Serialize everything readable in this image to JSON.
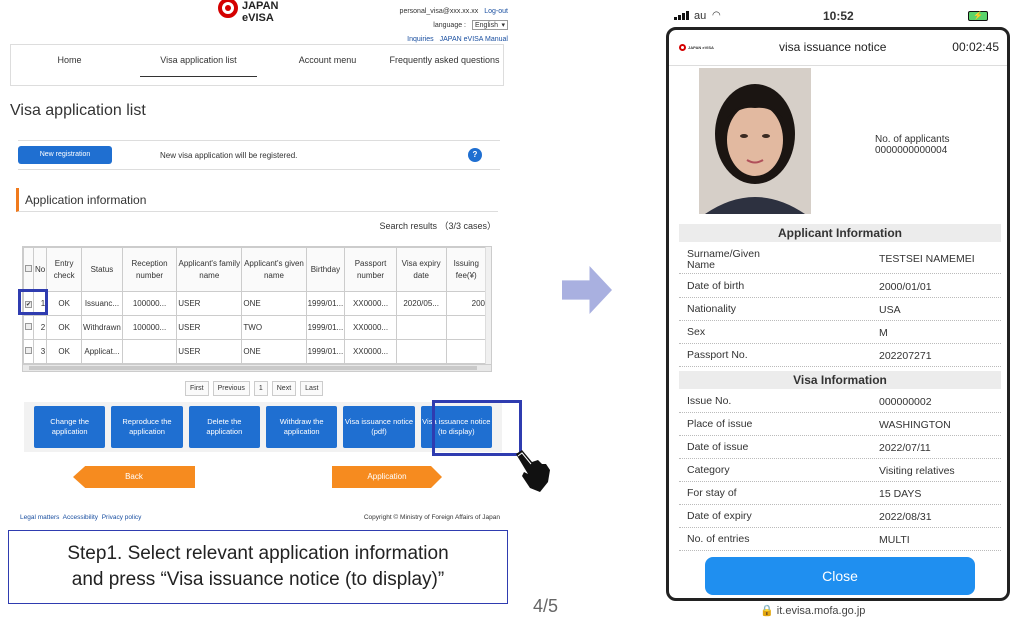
{
  "header": {
    "logo_line1": "JAPAN",
    "logo_line2": "eVISA",
    "email": "personal_visa@xxx.xx.xx",
    "logout": "Log-out",
    "language_label": "language :",
    "language_value": "English",
    "inquiries": "Inquiries",
    "manual": "JAPAN eVISA Manual"
  },
  "nav": {
    "items": [
      "Home",
      "Visa application list",
      "Account menu",
      "Frequently asked questions"
    ]
  },
  "page_title": "Visa application list",
  "registration": {
    "button": "New registration",
    "text": "New visa application will be registered.",
    "help": "?"
  },
  "section_title": "Application information",
  "search_results": "Search results （3/3 cases）",
  "table": {
    "headers": [
      "No",
      "Entry check",
      "Status",
      "Reception number",
      "Applicant's family name",
      "Applicant's given name",
      "Birthday",
      "Passport number",
      "Visa expiry date",
      "Issuing fee(¥)"
    ],
    "rows": [
      {
        "checked": "✔",
        "no": "1",
        "entry": "OK",
        "status": "Issuanc...",
        "reception": "100000...",
        "family": "USER",
        "given": "ONE",
        "birthday": "1999/01...",
        "passport": "XX0000...",
        "expiry": "2020/05...",
        "fee": "200"
      },
      {
        "checked": "",
        "no": "2",
        "entry": "OK",
        "status": "Withdrawn",
        "reception": "100000...",
        "family": "USER",
        "given": "TWO",
        "birthday": "1999/01...",
        "passport": "XX0000...",
        "expiry": "",
        "fee": ""
      },
      {
        "checked": "",
        "no": "3",
        "entry": "OK",
        "status": "Applicat...",
        "reception": "",
        "family": "USER",
        "given": "ONE",
        "birthday": "1999/01...",
        "passport": "XX0000...",
        "expiry": "",
        "fee": ""
      }
    ]
  },
  "pager": {
    "first": "First",
    "previous": "Previous",
    "page": "1",
    "next": "Next",
    "last": "Last"
  },
  "actions": [
    "Change the application",
    "Reproduce the application",
    "Delete the application",
    "Withdraw the application",
    "Visa issuance notice (pdf)",
    "Visa issuance notice (to display)"
  ],
  "back": "Back",
  "application": "Application",
  "footer": {
    "legal": "Legal matters",
    "accessibility": "Accessibility",
    "privacy": "Privacy policy",
    "copyright": "Copyright © Ministry of Foreign Affairs of Japan"
  },
  "step": {
    "line1": "Step1. Select relevant application information",
    "line2": "and press “Visa issuance notice (to display)”"
  },
  "page_number": "4/5",
  "phone": {
    "carrier": "au",
    "time": "10:52",
    "logo": "JAPAN eVISA",
    "title": "visa issuance notice",
    "timer": "00:02:45",
    "applicants_label": "No. of applicants",
    "applicants_value": "0000000000004",
    "applicant_section": "Applicant Information",
    "applicant_rows": [
      {
        "k": "Surname/Given Name",
        "v": "TESTSEI NAMEMEI"
      },
      {
        "k": "Date of birth",
        "v": "2000/01/01"
      },
      {
        "k": "Nationality",
        "v": "USA"
      },
      {
        "k": "Sex",
        "v": "M"
      },
      {
        "k": "Passport No.",
        "v": "202207271"
      }
    ],
    "visa_section": "Visa Information",
    "visa_rows": [
      {
        "k": "Issue No.",
        "v": "000000002"
      },
      {
        "k": "Place of issue",
        "v": "WASHINGTON"
      },
      {
        "k": "Date of issue",
        "v": "2022/07/11"
      },
      {
        "k": "Category",
        "v": "Visiting relatives"
      },
      {
        "k": "For stay of",
        "v": "15 DAYS"
      },
      {
        "k": "Date of expiry",
        "v": "2022/08/31"
      },
      {
        "k": "No. of entries",
        "v": "MULTI"
      }
    ],
    "close": "Close",
    "url": "it.evisa.mofa.go.jp"
  }
}
